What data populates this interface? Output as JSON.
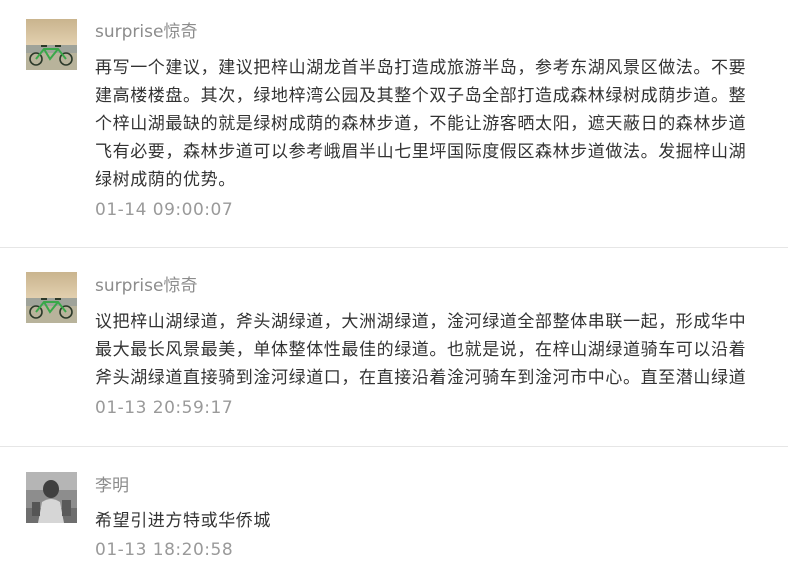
{
  "comments": [
    {
      "user": "surprise惊奇",
      "avatar_icon": "tandem-bicycle-lake-avatar",
      "lines": [
        "再写一个建议，建议把梓山湖龙首半岛打造成旅游半岛，参考东湖风景区做法。不要",
        "建高楼楼盘。其次，绿地梓湾公园及其整个双子岛全部打造成森林绿树成荫步道。整",
        "个梓山湖最缺的就是绿树成荫的森林步道，不能让游客晒太阳，遮天蔽日的森林步道",
        "飞有必要，森林步道可以参考峨眉半山七里坪国际度假区森林步道做法。发掘梓山湖",
        "绿树成荫的优势。"
      ],
      "time": "01-14 09:00:07"
    },
    {
      "user": "surprise惊奇",
      "avatar_icon": "tandem-bicycle-lake-avatar",
      "lines": [
        "议把梓山湖绿道，斧头湖绿道，大洲湖绿道，淦河绿道全部整体串联一起，形成华中",
        "最大最长风景最美，单体整体性最佳的绿道。也就是说，在梓山湖绿道骑车可以沿着",
        "斧头湖绿道直接骑到淦河绿道口，在直接沿着淦河骑车到淦河市中心。直至潜山绿道"
      ],
      "time": "01-13 20:59:17"
    },
    {
      "user": "李明",
      "avatar_icon": "child-photo-avatar",
      "lines": [
        "希望引进方特或华侨城"
      ],
      "time": "01-13 18:20:58"
    }
  ]
}
